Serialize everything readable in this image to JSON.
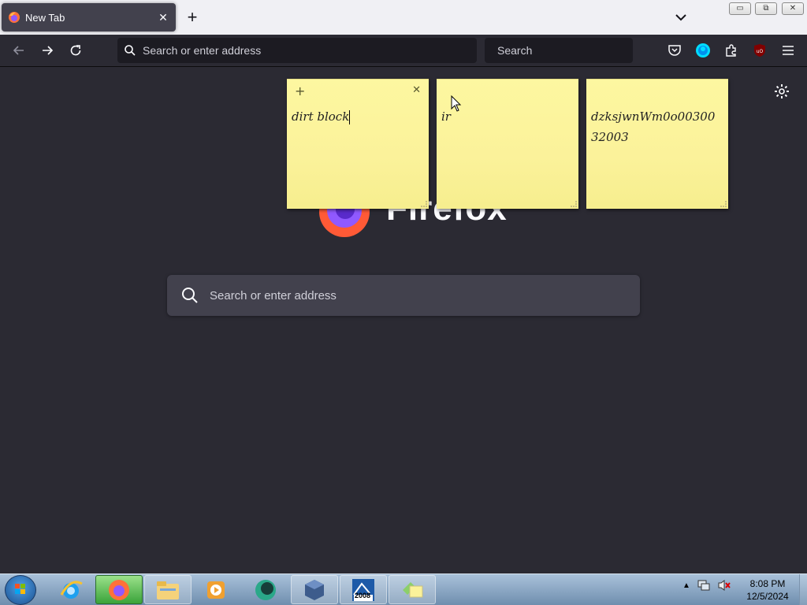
{
  "tab": {
    "title": "New Tab",
    "close": "✕"
  },
  "window_controls": {
    "minimize": "▭",
    "restore": "⧉",
    "close": "✕"
  },
  "navbar": {
    "address_placeholder": "Search or enter address",
    "search_placeholder": "Search"
  },
  "content": {
    "wordmark": "Firefox",
    "search_placeholder": "Search or enter address"
  },
  "sticky_notes": [
    {
      "text": "dirt block",
      "plus": "+",
      "close": "✕"
    },
    {
      "text": "ir"
    },
    {
      "text": "dzksjwnWm0o00300 32003"
    }
  ],
  "taskbar": {
    "apps": [
      "internet-explorer",
      "firefox",
      "file-explorer",
      "media-player",
      "app-green",
      "virtualbox",
      "app-2008",
      "sticky-notes"
    ],
    "app_2008_label": "2008",
    "clock_time": "8:08 PM",
    "clock_date": "12/5/2024"
  },
  "colors": {
    "page_bg": "#2b2a33",
    "tabstrip_bg": "#f0f0f4",
    "note_yellow": "#fdf7a0",
    "accent_blue": "#00ddff"
  }
}
